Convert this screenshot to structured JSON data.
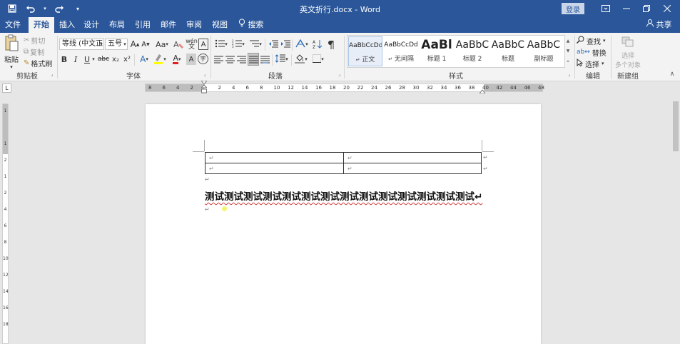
{
  "titlebar": {
    "document_title": "英文折行.docx - Word",
    "signin_label": "登录",
    "qat_icons": [
      "save-icon",
      "undo-icon",
      "redo-icon",
      "customize-icon"
    ]
  },
  "tabs": [
    {
      "label": "文件",
      "active": false
    },
    {
      "label": "开始",
      "active": true
    },
    {
      "label": "插入",
      "active": false
    },
    {
      "label": "设计",
      "active": false
    },
    {
      "label": "布局",
      "active": false
    },
    {
      "label": "引用",
      "active": false
    },
    {
      "label": "邮件",
      "active": false
    },
    {
      "label": "审阅",
      "active": false
    },
    {
      "label": "视图",
      "active": false
    }
  ],
  "search_label": "搜索",
  "share_label": "共享",
  "clipboard": {
    "paste_label": "粘贴",
    "cut_label": "剪切",
    "copy_label": "复制",
    "format_painter_label": "格式刷",
    "group_label": "剪贴板"
  },
  "font": {
    "font_name": "等线 (中文正",
    "font_size": "五号",
    "group_label": "字体",
    "grow_label": "A",
    "shrink_label": "A",
    "case_label": "Aa",
    "phonetic_label": "wén",
    "charborder_label": "A",
    "bold": "B",
    "italic": "I",
    "underline": "U",
    "strike": "abc",
    "subscript": "x₂",
    "superscript": "x²",
    "font_color_label": "A",
    "text_effects_label": "A",
    "char_shading_label": "A",
    "enclose_label": "字"
  },
  "paragraph": {
    "group_label": "段落"
  },
  "styles": {
    "group_label": "样式",
    "items": [
      {
        "sample": "AaBbCcDd",
        "name": "正文",
        "selected": true
      },
      {
        "sample": "AaBbCcDd",
        "name": "无间隔",
        "selected": false
      },
      {
        "sample": "AaBl",
        "name": "标题 1",
        "selected": false
      },
      {
        "sample": "AaBbC",
        "name": "标题 2",
        "selected": false
      },
      {
        "sample": "AaBbC",
        "name": "标题",
        "selected": false
      },
      {
        "sample": "AaBbC",
        "name": "副标题",
        "selected": false
      }
    ]
  },
  "editing": {
    "find_label": "查找",
    "replace_label": "替换",
    "select_label": "选择",
    "group_label": "编辑"
  },
  "newgroup": {
    "select_objects_line1": "选择",
    "select_objects_line2": "多个对象",
    "group_label": "新建组"
  },
  "ruler": {
    "horizontal_ticks": [
      "8",
      "6",
      "4",
      "2",
      "",
      "2",
      "4",
      "6",
      "8",
      "10",
      "12",
      "14",
      "16",
      "18",
      "20",
      "22",
      "24",
      "26",
      "28",
      "30",
      "32",
      "34",
      "36",
      "38",
      "40",
      "42",
      "44",
      "46",
      "48"
    ],
    "vertical_ticks": [
      "1",
      "",
      "1",
      "2",
      "1",
      "2",
      "4",
      "6",
      "8",
      "10",
      "12",
      "14",
      "16",
      "18"
    ],
    "tab_selector": "L"
  },
  "document": {
    "table": [
      [
        "↵",
        "↵"
      ],
      [
        "↵",
        "↵"
      ]
    ],
    "row_end_mark": "↵",
    "after_table_mark": "↵",
    "text_line": "测试测试测试测试测试测试测试测试测试测试测试测试测试测试↵",
    "empty_para_mark": "↵"
  }
}
